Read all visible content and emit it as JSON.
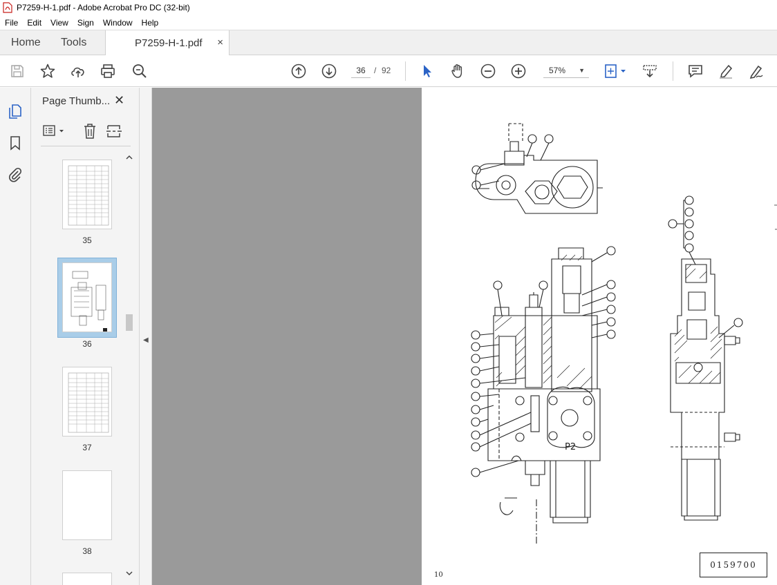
{
  "window": {
    "title": "P7259-H-1.pdf - Adobe Acrobat Pro DC (32-bit)"
  },
  "menu": [
    "File",
    "Edit",
    "View",
    "Sign",
    "Window",
    "Help"
  ],
  "tabs": {
    "home": "Home",
    "tools": "Tools",
    "document": "P7259-H-1.pdf",
    "close_symbol": "×"
  },
  "toolbar": {
    "icons": [
      "save-icon",
      "star-icon",
      "cloud-upload-icon",
      "print-icon",
      "zoom-search-icon",
      "arrow-up-icon",
      "arrow-down-icon",
      "select-pointer-icon",
      "hand-icon",
      "zoom-out-icon",
      "zoom-in-icon",
      "fit-page-icon",
      "scroll-mode-icon",
      "comment-icon",
      "highlight-pen-icon",
      "sign-icon"
    ],
    "current_page": "36",
    "page_separator": "/",
    "total_pages": "92",
    "zoom": "57%"
  },
  "side_panel": {
    "title": "Page Thumb...",
    "close_symbol": "✕",
    "thumbnails": [
      {
        "label": "35",
        "selected": false
      },
      {
        "label": "36",
        "selected": true
      },
      {
        "label": "37",
        "selected": false
      },
      {
        "label": "38",
        "selected": false
      }
    ]
  },
  "page_content": {
    "footer_page_number": "10",
    "drawing_number": "0159700",
    "port_label": "P2"
  },
  "colors": {
    "accent_blue": "#2b63c6",
    "selected_thumb_bg": "#a9cde8",
    "canvas_gray": "#9a9a9a"
  }
}
